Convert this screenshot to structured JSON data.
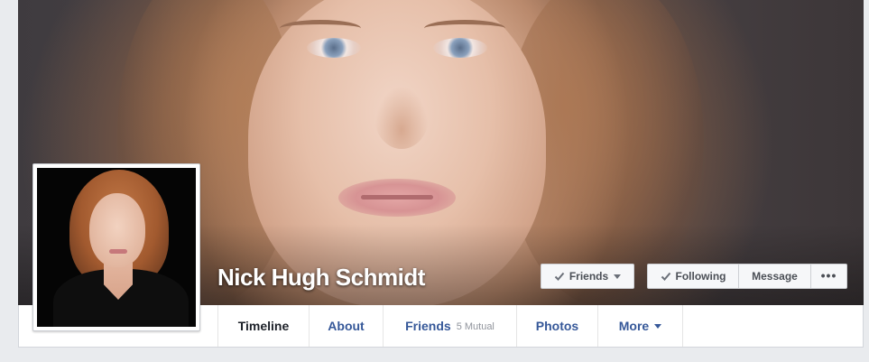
{
  "profile": {
    "name": "Nick Hugh Schmidt"
  },
  "actions": {
    "friends_label": "Friends",
    "following_label": "Following",
    "message_label": "Message",
    "more_label": "•••"
  },
  "tabs": [
    {
      "label": "Timeline",
      "active": true
    },
    {
      "label": "About"
    },
    {
      "label": "Friends",
      "sub": "5 Mutual"
    },
    {
      "label": "Photos"
    },
    {
      "label": "More"
    }
  ],
  "icons": {
    "check": "check-icon",
    "caret": "caret-down-icon",
    "more": "more-dots-icon"
  },
  "colors": {
    "link_blue": "#365899",
    "active_text": "#1d2129",
    "button_bg": "#f6f7f9",
    "page_bg": "#e9ebee"
  }
}
